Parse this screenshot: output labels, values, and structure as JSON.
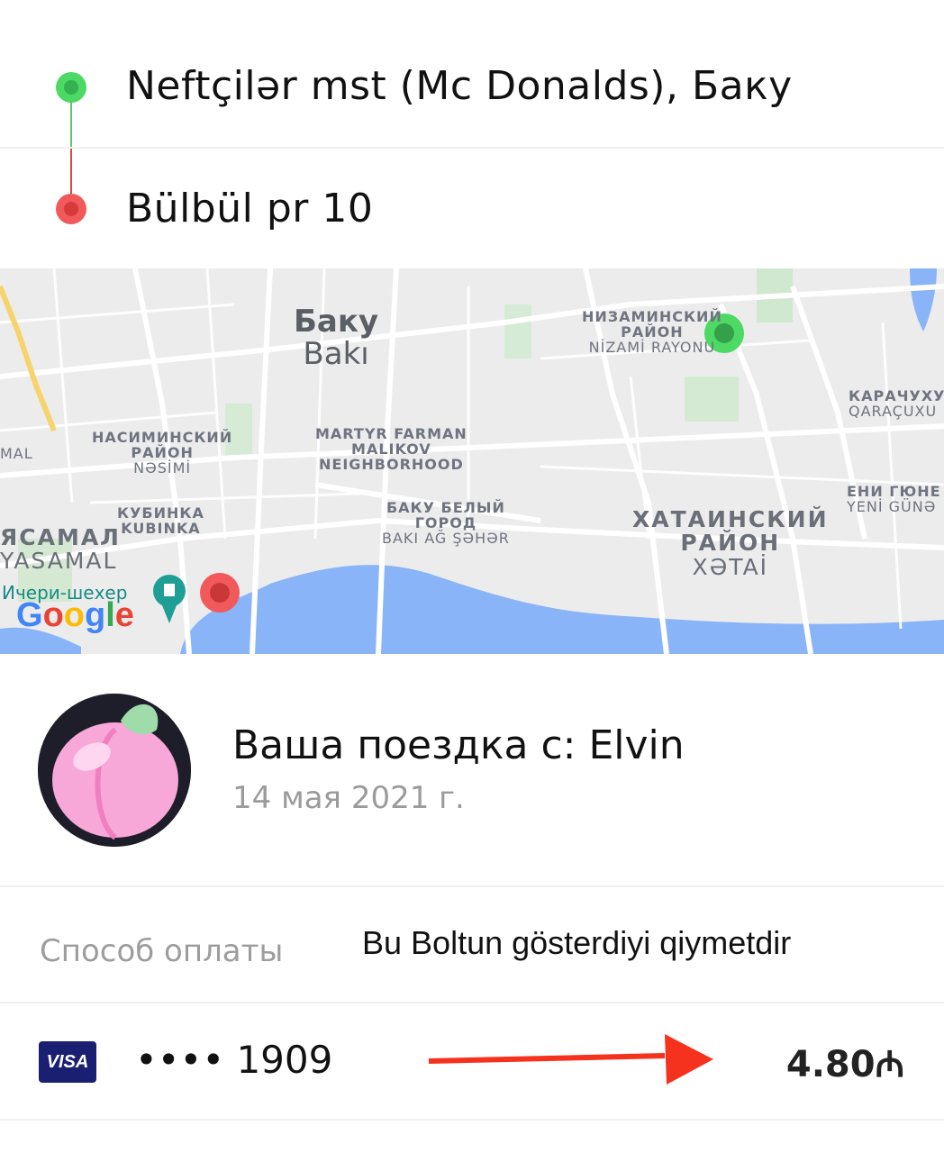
{
  "route": {
    "origin": "Neftçilər mst (Mc Donalds), Баку",
    "destination": "Bülbül pr 10"
  },
  "map": {
    "labels": {
      "baku_ru": "Баку",
      "baku_az": "Bakı",
      "nizami_ru_1": "НИЗАМИНСКИЙ",
      "nizami_ru_2": "РАЙОН",
      "nizami_az": "NİZAMİ RAYONU",
      "garachukhur_ru": "КАРАЧУХУ",
      "garachukhur_az": "QARAÇUXU",
      "nasimi_ru_1": "НАСИМИНСКИЙ",
      "nasimi_ru_2": "РАЙОН",
      "nasimi_az": "NƏSİMİ",
      "martyr_1": "MARTYR FARMAN",
      "martyr_2": "MALIKOV",
      "martyr_3": "NEIGHBORHOOD",
      "yeni_gunesh_ru": "ЕНИ ГЮНЕ",
      "yeni_gunesh_az": "YENİ GÜNƏ",
      "kubinka_ru": "КУБИНКА",
      "kubinka_az": "KUBINKA",
      "white_city_ru_1": "БАКУ БЕЛЫЙ",
      "white_city_ru_2": "ГОРОД",
      "white_city_az": "BAKI AĞ ŞƏHƏR",
      "khatai_ru_1": "ХАТАИНСКИЙ",
      "khatai_ru_2": "РАЙОН",
      "khatai_az": "XƏTAİ",
      "yasamal_ru": "ЯСАМАЛ",
      "yasamal_az": "YASAMAL",
      "icheri_sheher": "Ичери-шехер",
      "mal_partial": "MAL",
      "google": "Google"
    },
    "colors": {
      "origin": "#4cd964",
      "destination": "#f2595a",
      "water": "#8ab4f8"
    }
  },
  "trip": {
    "title": "Ваша поездка с: Elvin",
    "date": "14 мая 2021 г."
  },
  "payment": {
    "label": "Способ оплаты",
    "note": "Bu Boltun gösterdiyi qiymetdir",
    "card_brand": "VISA",
    "card_mask": "•••• 1909",
    "price": "4.80₼"
  }
}
